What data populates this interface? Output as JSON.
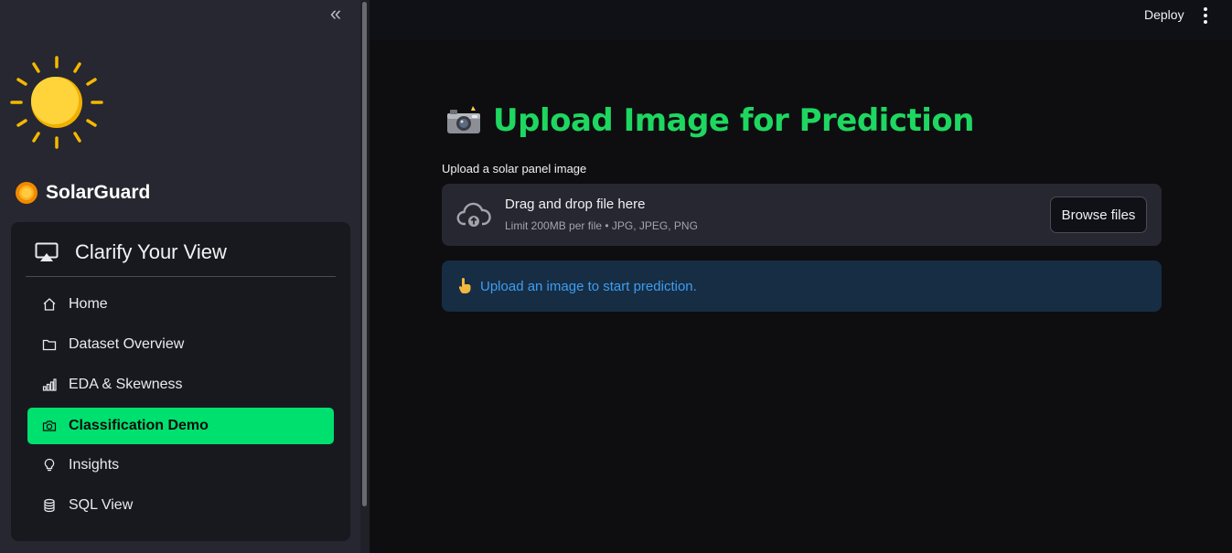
{
  "sidebar": {
    "brand": {
      "title": "SolarGuard",
      "icon": "sun-icon"
    },
    "menu": {
      "title": "Clarify Your View",
      "title_icon": "cast-icon",
      "items": [
        {
          "label": "Home",
          "icon": "home-icon",
          "active": false
        },
        {
          "label": "Dataset Overview",
          "icon": "folder-icon",
          "active": false
        },
        {
          "label": "EDA & Skewness",
          "icon": "bar-chart-icon",
          "active": false
        },
        {
          "label": "Classification Demo",
          "icon": "camera-icon",
          "active": true
        },
        {
          "label": "Insights",
          "icon": "lightbulb-icon",
          "active": false
        },
        {
          "label": "SQL View",
          "icon": "database-icon",
          "active": false
        }
      ]
    },
    "collapse_icon": "double-chevron-left-icon"
  },
  "topbar": {
    "deploy_label": "Deploy",
    "menu_icon": "kebab-menu-icon"
  },
  "main": {
    "title": "Upload Image for Prediction",
    "title_icon": "camera-flash-emoji",
    "uploader": {
      "label": "Upload a solar panel image",
      "drop_text": "Drag and drop file here",
      "limit_text": "Limit 200MB per file • JPG, JPEG, PNG",
      "browse_label": "Browse files",
      "icon": "cloud-upload-icon"
    },
    "info": {
      "text": "Upload an image to start prediction.",
      "icon": "pointing-hand-emoji"
    }
  },
  "colors": {
    "accent": "#00e06e",
    "title_green": "#1ed760",
    "info_bg": "#172d43",
    "info_text": "#3d9df3",
    "sidebar_bg": "#262730",
    "main_bg": "#0e0e10"
  }
}
